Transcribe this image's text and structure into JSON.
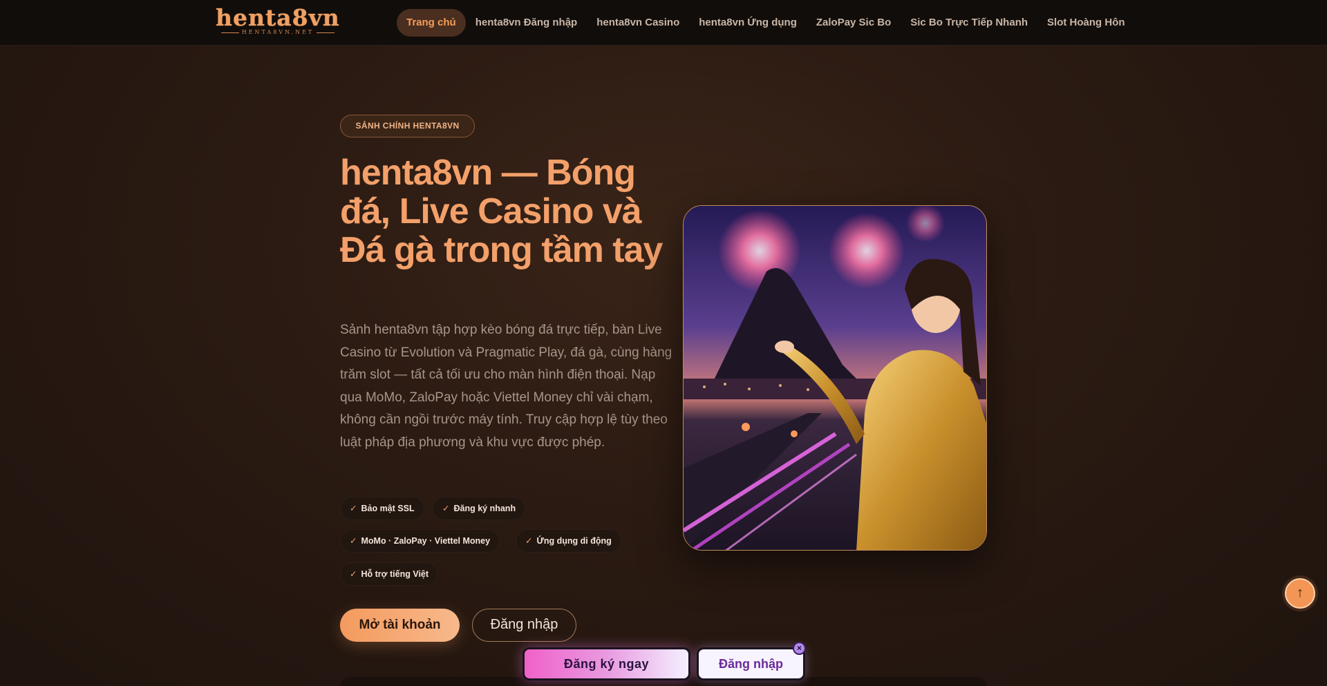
{
  "header": {
    "logo_text": "henta8vn",
    "logo_subtext": "HENTA8VN.NET",
    "nav": [
      {
        "label": "Trang chủ",
        "active": true
      },
      {
        "label": "henta8vn Đăng nhập",
        "active": false
      },
      {
        "label": "henta8vn Casino",
        "active": false
      },
      {
        "label": "henta8vn Ứng dụng",
        "active": false
      },
      {
        "label": "ZaloPay Sic Bo",
        "active": false
      },
      {
        "label": "Sic Bo Trực Tiếp Nhanh",
        "active": false
      },
      {
        "label": "Slot Hoàng Hôn",
        "active": false
      }
    ]
  },
  "hero": {
    "badge": "SẢNH CHÍNH HENTA8VN",
    "title": "henta8vn — Bóng đá, Live Casino và Đá gà trong tầm tay",
    "description": "Sảnh henta8vn tập hợp kèo bóng đá trực tiếp, bàn Live Casino từ Evolution và Pragmatic Play, đá gà, cùng hàng trăm slot — tất cả tối ưu cho màn hình điện thoại. Nạp qua MoMo, ZaloPay hoặc Viettel Money chỉ vài chạm, không cần ngồi trước máy tính. Truy cập hợp lệ tùy theo luật pháp địa phương và khu vực được phép.",
    "features": [
      "Bảo mật SSL",
      "Đăng ký nhanh",
      "MoMo · ZaloPay · Viettel Money",
      "Ứng dụng di động",
      "Hỗ trợ tiếng Việt"
    ],
    "check_glyph": "✓",
    "cta_primary": "Mở tài khoản",
    "cta_secondary": "Đăng nhập"
  },
  "sticky_bar": {
    "register": "Đăng ký ngay",
    "login": "Đăng nhập",
    "close_glyph": "×"
  },
  "scroll_top_glyph": "↑",
  "icons": {
    "scroll_top": "arrow-up-icon",
    "close": "close-icon",
    "check": "check-icon"
  },
  "colors": {
    "accent": "#f3a06a",
    "background": "#2a1a12",
    "header_bg": "#110d0b",
    "sticky_pink": "#f061c8"
  }
}
